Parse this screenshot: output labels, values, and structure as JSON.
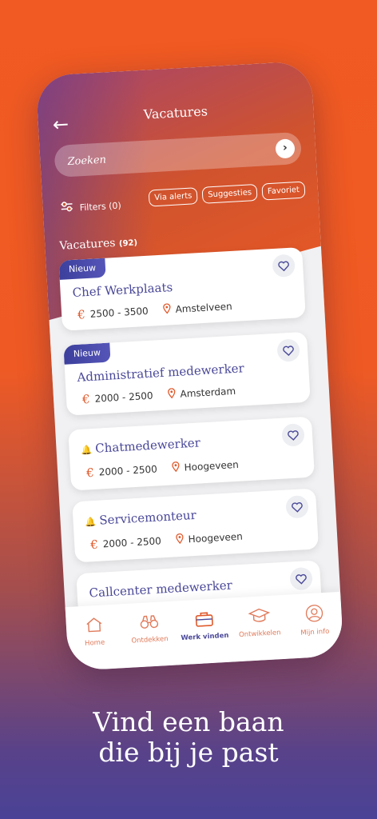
{
  "header": {
    "title": "Vacatures",
    "back_icon": "arrow-left-icon"
  },
  "search": {
    "placeholder": "Zoeken"
  },
  "filters": {
    "label": "Filters (0)",
    "chips": [
      "Via alerts",
      "Suggesties",
      "Favoriet"
    ]
  },
  "list": {
    "title": "Vacatures",
    "count": "(92)"
  },
  "jobs": [
    {
      "badge": "Nieuw",
      "title": "Chef Werkplaats",
      "salary": "2500 - 3500",
      "location": "Amstelveen"
    },
    {
      "badge": "Nieuw",
      "title": "Administratief medewerker",
      "salary": "2000 - 2500",
      "location": "Amsterdam"
    },
    {
      "badge": "",
      "title": "Chatmedewerker",
      "salary": "2000 - 2500",
      "location": "Hoogeveen"
    },
    {
      "badge": "",
      "title": "Servicemonteur",
      "salary": "2000 - 2500",
      "location": "Hoogeveen"
    },
    {
      "badge": "",
      "title": "Callcenter medewerker",
      "salary": "",
      "location": ""
    }
  ],
  "currency_symbol": "€",
  "tabs": [
    {
      "label": "Home",
      "icon": "home-icon"
    },
    {
      "label": "Ontdekken",
      "icon": "binoculars-icon"
    },
    {
      "label": "Werk vinden",
      "icon": "briefcase-icon",
      "active": true
    },
    {
      "label": "Ontwikkelen",
      "icon": "graduation-cap-icon"
    },
    {
      "label": "Mijn info",
      "icon": "user-icon"
    }
  ],
  "tagline": {
    "line1": "Vind een baan",
    "line2": "die bij je past"
  },
  "colors": {
    "accent": "#f15a22",
    "primary": "#4a4898"
  }
}
